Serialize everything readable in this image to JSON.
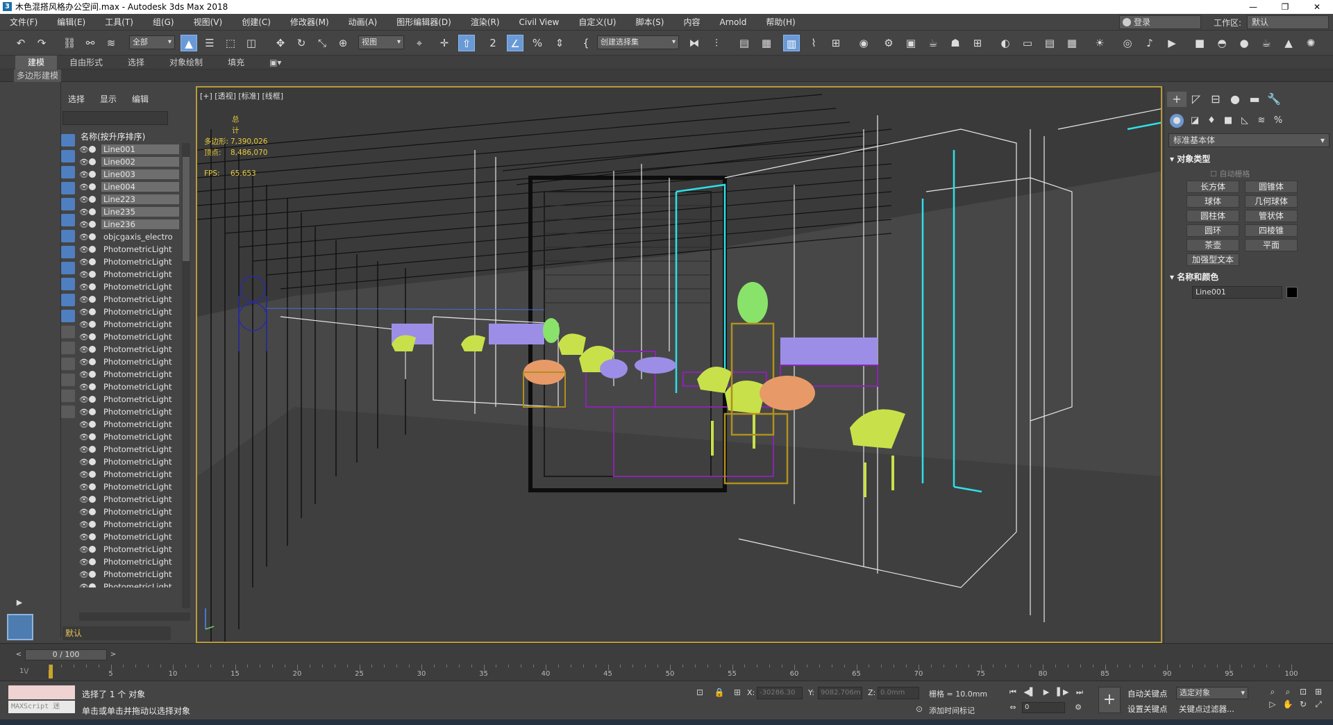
{
  "window": {
    "app_icon": "3",
    "title": "木色混搭风格办公空间.max - Autodesk 3ds Max 2018",
    "controls": [
      "—",
      "❐",
      "✕"
    ]
  },
  "menu": {
    "items": [
      "文件(F)",
      "编辑(E)",
      "工具(T)",
      "组(G)",
      "视图(V)",
      "创建(C)",
      "修改器(M)",
      "动画(A)",
      "图形编辑器(D)",
      "渲染(R)",
      "Civil View",
      "自定义(U)",
      "脚本(S)",
      "内容",
      "Arnold",
      "帮助(H)"
    ],
    "login": "登录",
    "workspace_label": "工作区:",
    "workspace_value": "默认"
  },
  "toolbar": {
    "selection_filter": "全部",
    "ref_coord": "视图",
    "named_selection": "创建选择集"
  },
  "ribbon": {
    "tabs": [
      "建模",
      "自由形式",
      "选择",
      "对象绘制",
      "填充"
    ],
    "sub_label": "多边形建模"
  },
  "scene_explorer": {
    "tabs": [
      "选择",
      "显示",
      "编辑"
    ],
    "header": "名称(按升序排序)",
    "rows": [
      "Line001",
      "Line002",
      "Line003",
      "Line004",
      "Line223",
      "Line235",
      "Line236",
      "objcgaxis_electro",
      "PhotometricLight",
      "PhotometricLight",
      "PhotometricLight",
      "PhotometricLight",
      "PhotometricLight",
      "PhotometricLight",
      "PhotometricLight",
      "PhotometricLight",
      "PhotometricLight",
      "PhotometricLight",
      "PhotometricLight",
      "PhotometricLight",
      "PhotometricLight",
      "PhotometricLight",
      "PhotometricLight",
      "PhotometricLight",
      "PhotometricLight",
      "PhotometricLight",
      "PhotometricLight",
      "PhotometricLight",
      "PhotometricLight",
      "PhotometricLight",
      "PhotometricLight",
      "PhotometricLight",
      "PhotometricLight",
      "PhotometricLight",
      "PhotometricLight",
      "PhotometricLight",
      "PhotometricLight"
    ],
    "layer": "默认"
  },
  "viewport": {
    "label": "[+] [透视] [标准] [线框]",
    "stats_title": "总计",
    "polys_label": "多边形:",
    "polys_value": "7,390,026",
    "verts_label": "顶点:",
    "verts_value": "8,486,070",
    "fps_label": "FPS:",
    "fps_value": "65.653"
  },
  "command_panel": {
    "category": "标准基本体",
    "object_type_title": "对象类型",
    "autogrid": "自动栅格",
    "buttons": [
      "长方体",
      "圆锥体",
      "球体",
      "几何球体",
      "圆柱体",
      "管状体",
      "圆环",
      "四棱锥",
      "茶壶",
      "平面",
      "加强型文本"
    ],
    "name_color_title": "名称和颜色",
    "object_name": "Line001"
  },
  "timeline": {
    "slider": "0 / 100",
    "ticks": [
      "0",
      "5",
      "10",
      "15",
      "20",
      "25",
      "30",
      "35",
      "40",
      "45",
      "50",
      "55",
      "60",
      "65",
      "70",
      "75",
      "80",
      "85",
      "90",
      "95",
      "100"
    ]
  },
  "status": {
    "maxscript": "MAXScript 迷",
    "selected": "选择了 1 个 对象",
    "hint": "单击或单击并拖动以选择对象",
    "x_label": "X:",
    "x_value": "-30286.30",
    "y_label": "Y:",
    "y_value": "9082.706m",
    "z_label": "Z:",
    "z_value": "0.0mm",
    "grid": "栅格 = 10.0mm",
    "add_time_tag": "添加时间标记",
    "auto_key": "自动关键点",
    "set_key": "设置关键点",
    "selected_objects": "选定对象",
    "key_filters": "关键点过滤器...",
    "frame": "0"
  }
}
